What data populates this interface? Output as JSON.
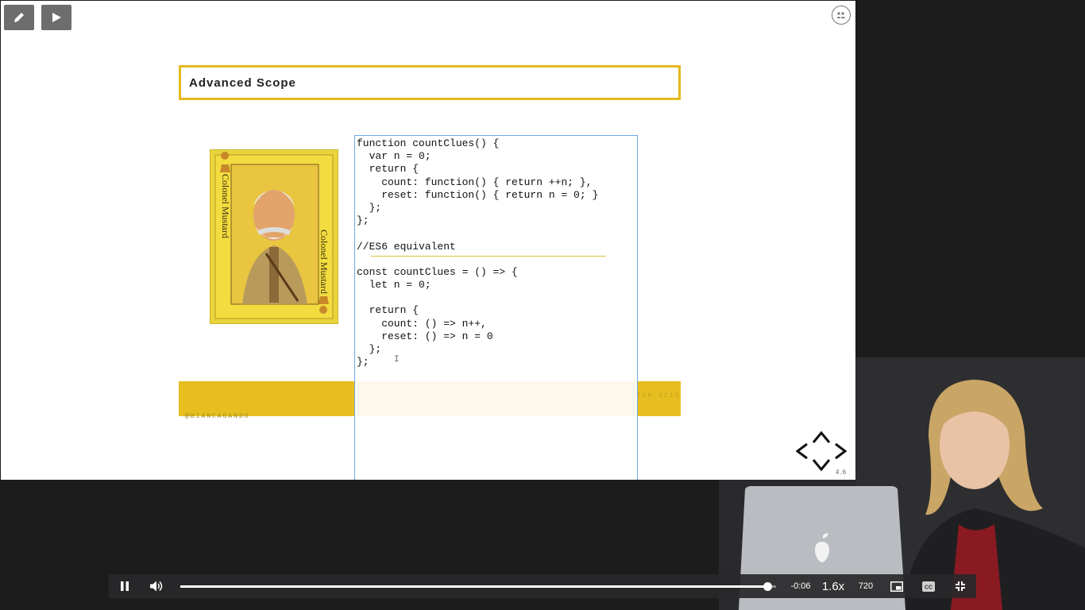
{
  "slide": {
    "title": "Advanced Scope",
    "code_lines": [
      "function countClues() {",
      "  var n = 0;",
      "  return {",
      "    count: function() { return ++n; },",
      "    reset: function() { return n = 0; }",
      "  };",
      "};",
      "",
      "//ES6 equivalent",
      "",
      "const countClues = () => {",
      "  let n = 0;",
      "",
      "  return {",
      "    count: () => n++,",
      "    reset: () => n = 0",
      "  };",
      "};"
    ],
    "card_text": "Colonel Mustard",
    "footer_left": "@BIANCAGANDO",
    "footer_right": "FEM 2015",
    "slide_number": "4.6",
    "accent_color": "#e6be1f"
  },
  "toolbar": {
    "draw_icon": "pencil-icon",
    "play_icon": "play-icon",
    "share_icon": "share-icon"
  },
  "player": {
    "time_remaining": "-0:06",
    "speed": "1.6x",
    "quality": "720",
    "progress": 0.985,
    "icons": {
      "pause": "pause-icon",
      "volume": "volume-icon",
      "pip": "picture-in-picture-icon",
      "captions": "captions-icon",
      "exit_fullscreen": "exit-fullscreen-icon"
    }
  }
}
